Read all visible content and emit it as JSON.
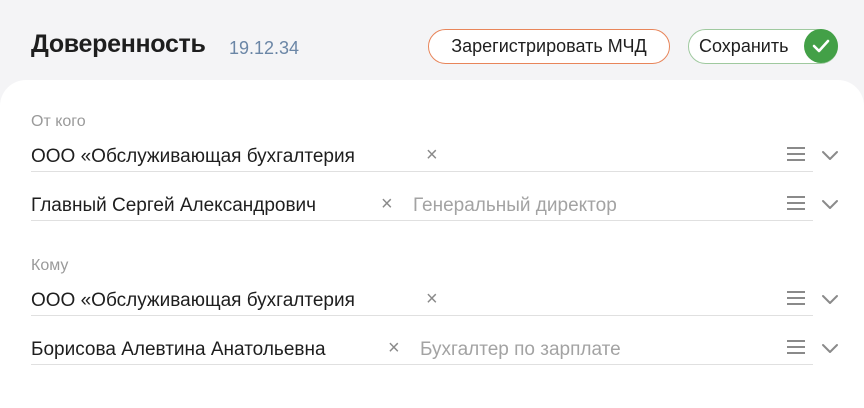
{
  "header": {
    "title": "Доверенность",
    "date": "19.12.34",
    "register_button": "Зарегистрировать МЧД",
    "save_button": "Сохранить"
  },
  "from": {
    "label": "От кого",
    "organization": "ООО «Обслуживающая бухгалтерия",
    "person": "Главный Сергей Александрович",
    "position_placeholder": "Генеральный директор"
  },
  "to": {
    "label": "Кому",
    "organization": "ООО «Обслуживающая бухгалтерия",
    "person": "Борисова Алевтина Анатольевна",
    "position_placeholder": "Бухгалтер по зарплате"
  },
  "icons": {
    "clear": "×",
    "check_color": "#43a047",
    "accent_register": "#e8855a",
    "accent_save": "#9fc99f"
  }
}
